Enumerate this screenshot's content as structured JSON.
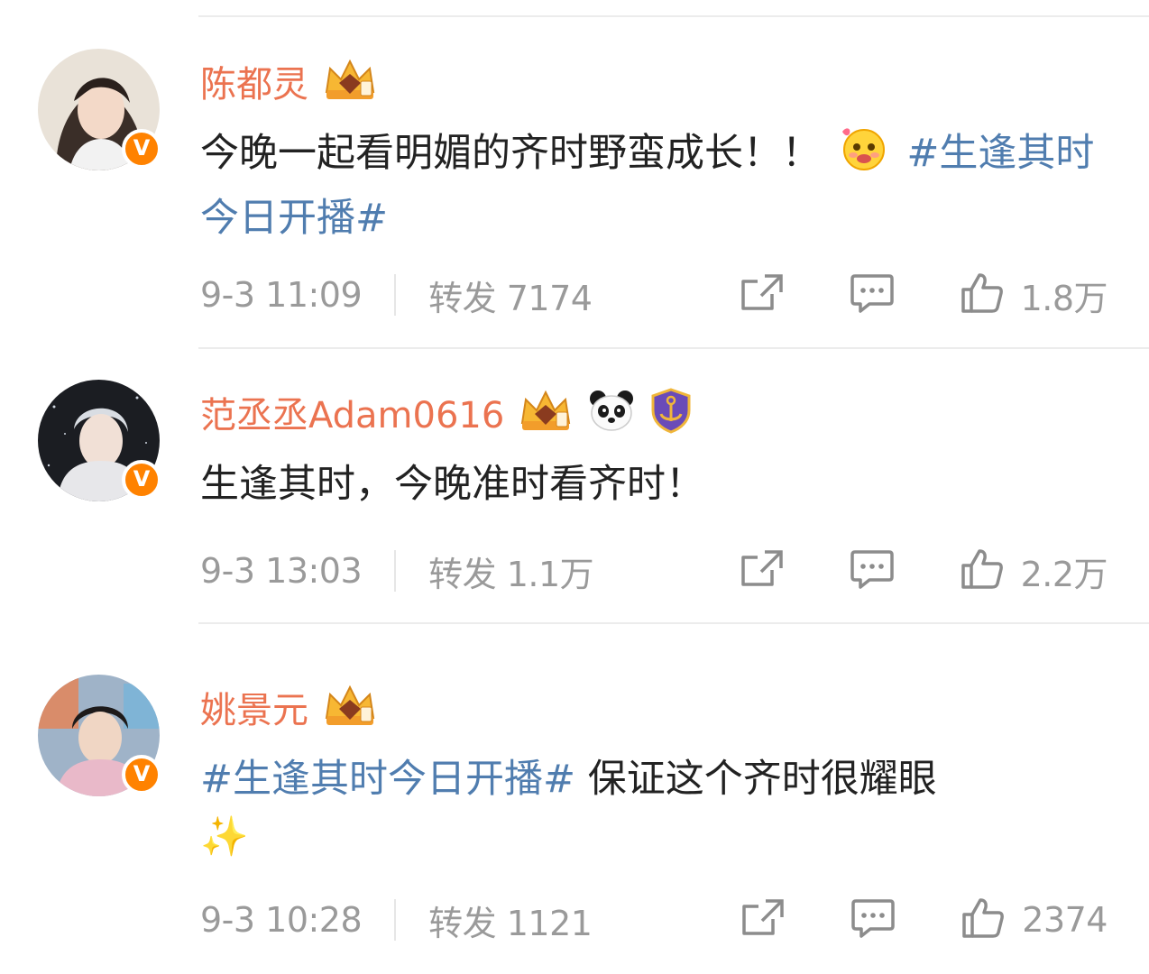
{
  "posts": [
    {
      "name": "陈都灵",
      "content": "今晚一起看明媚的齐时野蛮成长！！",
      "topic": "#生逢其时今日开播#",
      "time": "9-3 11:09",
      "repost": "转发 7174",
      "likes": "1.8万"
    },
    {
      "name": "范丞丞Adam0616",
      "content": "生逢其时，今晚准时看齐时！",
      "time": "9-3 13:03",
      "repost": "转发 1.1万",
      "likes": "2.2万"
    },
    {
      "name": "姚景元",
      "topic": "#生逢其时今日开播#",
      "content": " 保证这个齐时很耀眼",
      "emoji": "✨",
      "time": "9-3 10:28",
      "repost": "转发 1121",
      "likes": "2374"
    }
  ],
  "colors": {
    "name": "#eb7350",
    "topic": "#507daf",
    "meta": "#9a9a9a",
    "verified": "#ff8200"
  },
  "icons": [
    "crown-badge-icon",
    "panda-icon",
    "anchor-shield-icon",
    "smiling-face-emoji-icon",
    "share-icon",
    "comment-icon",
    "like-icon",
    "verified-v-icon"
  ]
}
